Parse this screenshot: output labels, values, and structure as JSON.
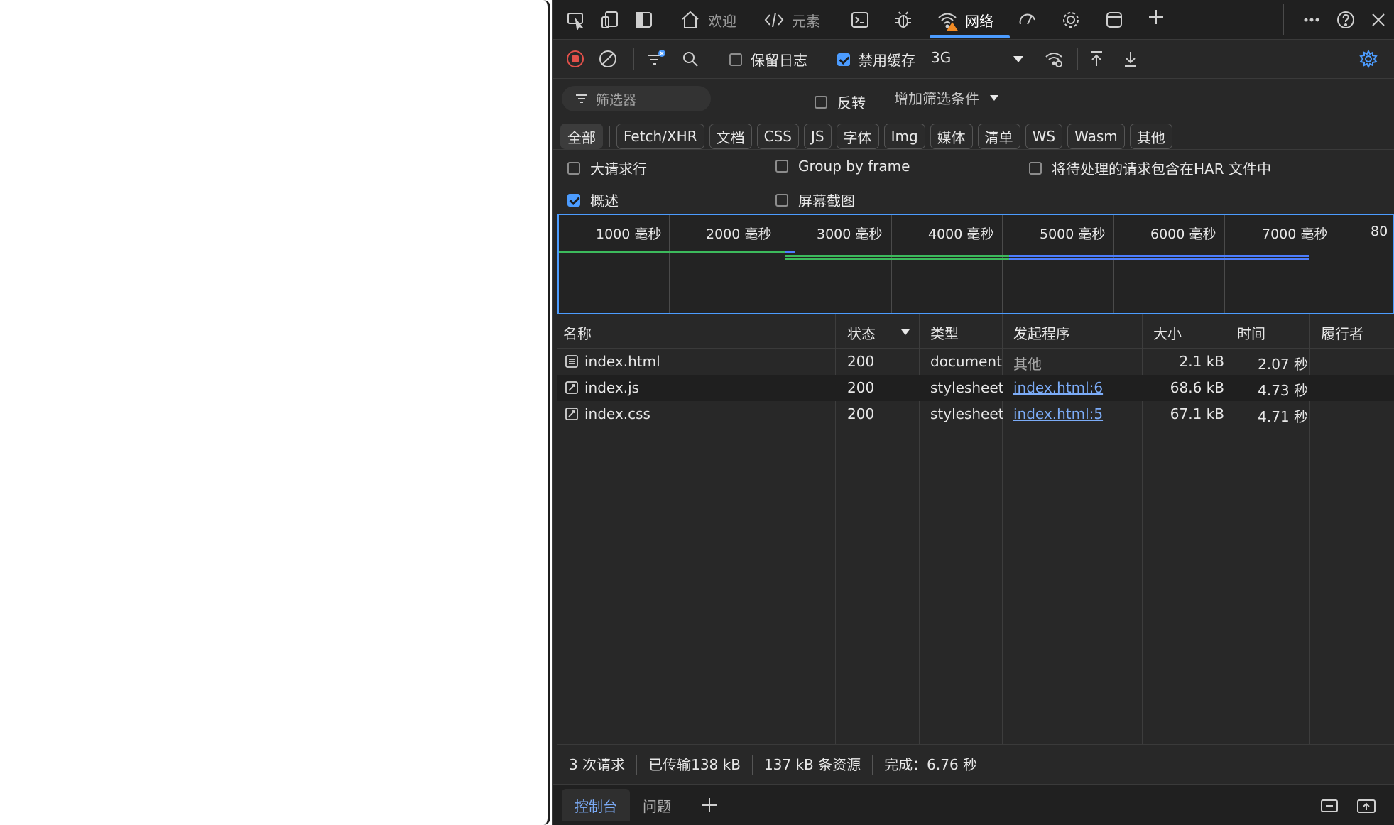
{
  "colors": {
    "accent": "#4c9cff",
    "link": "#7cacf8",
    "record": "#e2504a",
    "bar_green": "#3cba5c",
    "bar_blue": "#4c7dff"
  },
  "tabs": {
    "welcome": "欢迎",
    "elements": "元素",
    "network": "网络"
  },
  "toolbar": {
    "preserve_log": "保留日志",
    "disable_cache": "禁用缓存",
    "throttle": "3G",
    "preserve_log_checked": false,
    "disable_cache_checked": true
  },
  "filter": {
    "placeholder": "筛选器",
    "invert": "反转",
    "add_filter": "增加筛选条件"
  },
  "type_chips": [
    "全部",
    "Fetch/XHR",
    "文档",
    "CSS",
    "JS",
    "字体",
    "Img",
    "媒体",
    "清单",
    "WS",
    "Wasm",
    "其他"
  ],
  "options": {
    "big_rows": "大请求行",
    "group_by_frame": "Group by frame",
    "har_pending": "将待处理的请求包含在HAR 文件中",
    "overview": "概述",
    "screenshots": "屏幕截图"
  },
  "timeline": {
    "ticks": [
      "1000 毫秒",
      "2000 毫秒",
      "3000 毫秒",
      "4000 毫秒",
      "5000 毫秒",
      "6000 毫秒",
      "7000 毫秒",
      "80"
    ]
  },
  "table": {
    "headers": {
      "name": "名称",
      "status": "状态",
      "type": "类型",
      "initiator": "发起程序",
      "size": "大小",
      "time": "时间",
      "fulfilled": "履行者"
    },
    "rows": [
      {
        "name": "index.html",
        "status": "200",
        "type": "document",
        "initiator": "其他",
        "size": "2.1 kB",
        "time": "2.07 秒"
      },
      {
        "name": "index.js",
        "status": "200",
        "type": "stylesheet",
        "initiator": "index.html:6",
        "size": "68.6 kB",
        "time": "4.73 秒"
      },
      {
        "name": "index.css",
        "status": "200",
        "type": "stylesheet",
        "initiator": "index.html:5",
        "size": "67.1 kB",
        "time": "4.71 秒"
      }
    ]
  },
  "status": {
    "requests": "3 次请求",
    "transferred": "已传输138 kB",
    "resources": "137 kB 条资源",
    "finish": "完成：6.76 秒"
  },
  "drawer": {
    "console": "控制台",
    "issues": "问题"
  }
}
